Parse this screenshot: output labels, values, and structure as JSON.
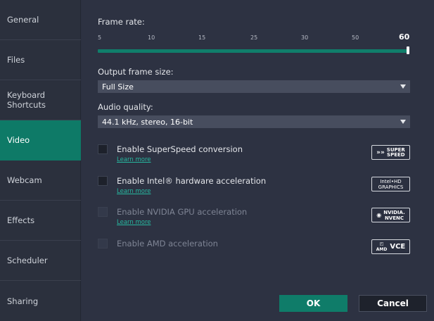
{
  "sidebar": {
    "items": [
      {
        "label": "General"
      },
      {
        "label": "Files"
      },
      {
        "label": "Keyboard\nShortcuts"
      },
      {
        "label": "Video"
      },
      {
        "label": "Webcam"
      },
      {
        "label": "Effects"
      },
      {
        "label": "Scheduler"
      },
      {
        "label": "Sharing"
      }
    ],
    "active_item": "Video"
  },
  "frame_rate": {
    "label": "Frame rate:",
    "ticks": [
      "5",
      "10",
      "15",
      "25",
      "30",
      "50",
      "60"
    ],
    "value": 60
  },
  "frame_size": {
    "label": "Output frame size:",
    "selected": "Full Size"
  },
  "audio_quality": {
    "label": "Audio quality:",
    "selected": "44.1 kHz, stereo, 16-bit"
  },
  "options": [
    {
      "label": "Enable SuperSpeed conversion",
      "learn_more": "Learn more",
      "logo": "SUPER SPEED",
      "disabled": false,
      "checked": false
    },
    {
      "label": "Enable Intel® hardware acceleration",
      "learn_more": "Learn more",
      "logo": "Intel HD GRAPHICS",
      "disabled": false,
      "checked": false
    },
    {
      "label": "Enable NVIDIA GPU acceleration",
      "learn_more": "Learn more",
      "logo": "NVIDIA NVENC",
      "disabled": true,
      "checked": false
    },
    {
      "label": "Enable AMD acceleration",
      "learn_more": "",
      "logo": "AMD VCE",
      "disabled": true,
      "checked": false
    }
  ],
  "buttons": {
    "ok": "OK",
    "cancel": "Cancel"
  },
  "colors": {
    "accent": "#0e7a67",
    "link": "#27b8a0",
    "background": "#2d3242"
  }
}
